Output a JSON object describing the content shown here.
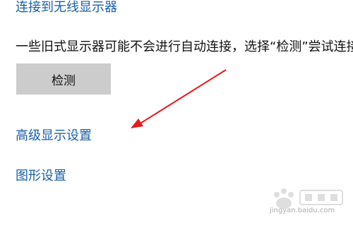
{
  "links": {
    "connect_wireless": "连接到无线显示器",
    "advanced_display": "高级显示设置",
    "graphics": "图形设置"
  },
  "description": "一些旧式显示器可能不会进行自动连接，选择“检测”尝试连接。",
  "detect_button": {
    "label": "检测"
  },
  "annotation": {
    "arrow_color": "#e8191a"
  },
  "watermark": {
    "text": "jingyan.baidu.com",
    "logo": "baidu-jingyan-logo"
  }
}
